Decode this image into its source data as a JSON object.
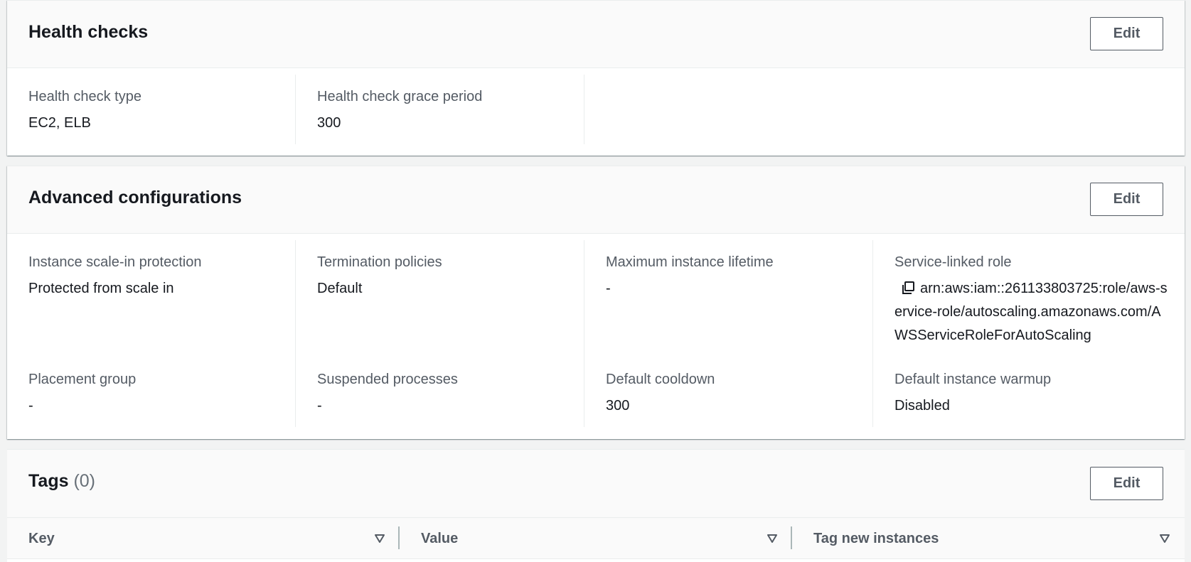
{
  "health_checks": {
    "title": "Health checks",
    "edit_label": "Edit",
    "fields": [
      {
        "label": "Health check type",
        "value": "EC2, ELB"
      },
      {
        "label": "Health check grace period",
        "value": "300"
      }
    ]
  },
  "advanced": {
    "title": "Advanced configurations",
    "edit_label": "Edit",
    "row1": [
      {
        "label": "Instance scale-in protection",
        "value": "Protected from scale in"
      },
      {
        "label": "Termination policies",
        "value": "Default"
      },
      {
        "label": "Maximum instance lifetime",
        "value": "-"
      },
      {
        "label": "Service-linked role",
        "value": "arn:aws:iam::261133803725:role/aws-service-role/autoscaling.amazonaws.com/AWSServiceRoleForAutoScaling",
        "icon": "copy-icon"
      }
    ],
    "row2": [
      {
        "label": "Placement group",
        "value": "-"
      },
      {
        "label": "Suspended processes",
        "value": "-"
      },
      {
        "label": "Default cooldown",
        "value": "300"
      },
      {
        "label": "Default instance warmup",
        "value": "Disabled"
      }
    ]
  },
  "tags": {
    "title": "Tags",
    "count": "(0)",
    "edit_label": "Edit",
    "columns": [
      "Key",
      "Value",
      "Tag new instances"
    ],
    "sort_icon": "sort-down-triangle-icon"
  },
  "colors": {
    "page_bg": "#f2f3f3",
    "header_bg": "#fafafa",
    "label_text": "#545b64",
    "value_text": "#16191f",
    "border": "#eaeded"
  }
}
